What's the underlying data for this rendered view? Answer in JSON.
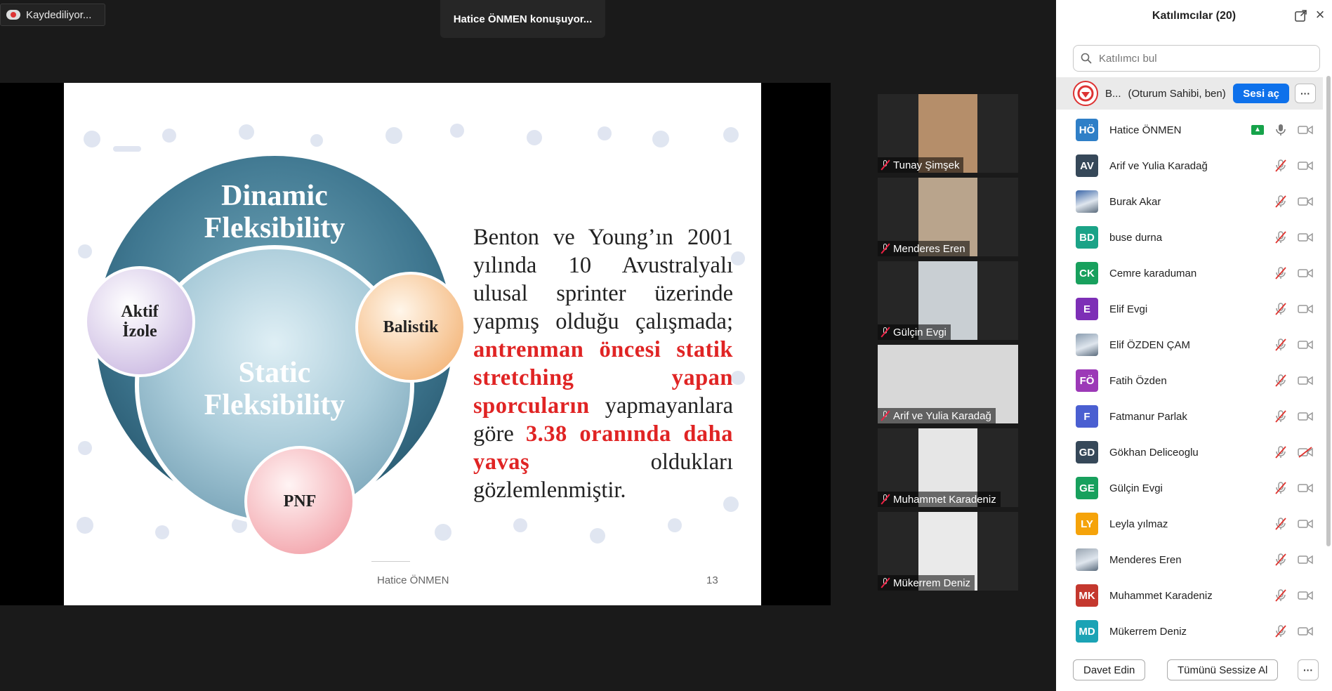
{
  "recording": {
    "label": "Kaydediliyor..."
  },
  "speaker": {
    "label": "Hatice ÖNMEN konuşuyor..."
  },
  "slide": {
    "circle_outer": [
      "Dinamic",
      "Fleksibility"
    ],
    "circle_inner": [
      "Static",
      "Fleksibility"
    ],
    "bubble_left": [
      "Aktif",
      "İzole"
    ],
    "bubble_right": "Balistik",
    "bubble_bottom": "PNF",
    "lines": [
      [
        {
          "t": "Benton ve Young’ın 2001",
          "red": false
        }
      ],
      [
        {
          "t": "yılında 10 Avustralyalı",
          "red": false
        }
      ],
      [
        {
          "t": "ulusal sprinter üzerinde",
          "red": false
        }
      ],
      [
        {
          "t": "yapmış olduğu çalışmada;",
          "red": false
        }
      ],
      [
        {
          "t": "antrenman öncesi statik",
          "red": true
        }
      ],
      [
        {
          "t": "stretching yapan",
          "red": true
        }
      ],
      [
        {
          "t": "sporcuların",
          "red": true
        },
        {
          "t": " yapmayanlara",
          "red": false
        }
      ],
      [
        {
          "t": "göre ",
          "red": false
        },
        {
          "t": "3.38 oranında daha",
          "red": true
        }
      ],
      [
        {
          "t": "yavaş",
          "red": true
        },
        {
          "t": " oldukları",
          "red": false
        }
      ],
      [
        {
          "t": "gözlemlenmiştir.",
          "red": false
        }
      ]
    ],
    "footer_name": "Hatice ÖNMEN",
    "page_number": "13"
  },
  "video_tiles": [
    {
      "name": "Tunay Şimşek",
      "bg": "#b58e6a"
    },
    {
      "name": "Menderes Eren",
      "bg": "#b9a48c"
    },
    {
      "name": "Gülçin Evgi",
      "bg": "#c9cfd3"
    },
    {
      "name": "Arif ve Yulia Karadağ",
      "bg": "#d8d8d8"
    },
    {
      "name": "Muhammet Karadeniz",
      "bg": "#e6e6e6"
    },
    {
      "name": "Mükerrem Deniz",
      "bg": "#eaeaea"
    }
  ],
  "panel": {
    "title": "Katılımcılar (20)",
    "search_placeholder": "Katılımcı bul",
    "host": {
      "name": "B...",
      "role": "(Oturum Sahibi, ben)",
      "unmute_label": "Sesi aç",
      "more_label": "···"
    },
    "participants": [
      {
        "initials": "HÖ",
        "name": "Hatice ÖNMEN",
        "color": "#2f7fc7",
        "mic": "on",
        "sharing": true
      },
      {
        "initials": "AV",
        "name": "Arif ve Yulia Karadağ",
        "color": "#364859",
        "mic": "off"
      },
      {
        "initials": "",
        "name": "Burak Akar",
        "color": "#3a66a8",
        "mic": "off",
        "photo": true
      },
      {
        "initials": "BD",
        "name": "buse durna",
        "color": "#1ba387",
        "mic": "off"
      },
      {
        "initials": "CK",
        "name": "Cemre karaduman",
        "color": "#18a05d",
        "mic": "off"
      },
      {
        "initials": "E",
        "name": "Elif Evgi",
        "color": "#7d2fb6",
        "mic": "off"
      },
      {
        "initials": "",
        "name": "Elif ÖZDEN ÇAM",
        "color": "#8a9db0",
        "mic": "off",
        "photo": true
      },
      {
        "initials": "FÖ",
        "name": "Fatih Özden",
        "color": "#9c39b7",
        "mic": "off"
      },
      {
        "initials": "F",
        "name": "Fatmanur Parlak",
        "color": "#4a5fd1",
        "mic": "off"
      },
      {
        "initials": "GD",
        "name": "Gökhan Deliceoglu",
        "color": "#364859",
        "mic": "off",
        "cam_off_red": true
      },
      {
        "initials": "GE",
        "name": "Gülçin Evgi",
        "color": "#18a05d",
        "mic": "off"
      },
      {
        "initials": "LY",
        "name": "Leyla yılmaz",
        "color": "#f5a30a",
        "mic": "off"
      },
      {
        "initials": "",
        "name": "Menderes Eren",
        "color": "#9aa6b2",
        "mic": "off",
        "photo": true
      },
      {
        "initials": "MK",
        "name": "Muhammet Karadeniz",
        "color": "#c4382e",
        "mic": "off"
      },
      {
        "initials": "MD",
        "name": "Mükerrem Deniz",
        "color": "#1ba3b5",
        "mic": "off"
      }
    ],
    "invite_label": "Davet Edin",
    "mute_all_label": "Tümünü Sessize Al",
    "footer_more_label": "···"
  }
}
